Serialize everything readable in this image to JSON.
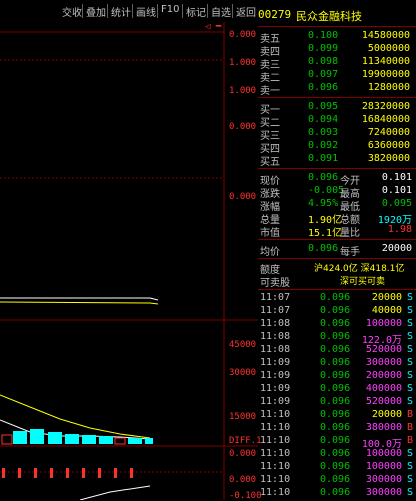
{
  "toolbar": {
    "items": [
      "交收",
      "叠加",
      "统计",
      "画线",
      "F10",
      "标记",
      "自选",
      "返回"
    ]
  },
  "chart": {
    "price_axis": [
      "0.000",
      "1.000",
      "1.000",
      "0.000",
      "0.000"
    ],
    "vol_axis": [
      "45000",
      "30000",
      "15000"
    ],
    "lower_axis": [
      "0.000",
      "0.000",
      "-0.100"
    ],
    "indicator_label": "DIFF.1"
  },
  "stock": {
    "code": "00279",
    "name": "民众金融科技"
  },
  "asks": [
    {
      "label": "卖五",
      "price": "0.100",
      "vol": "14580000"
    },
    {
      "label": "卖四",
      "price": "0.099",
      "vol": "5000000"
    },
    {
      "label": "卖三",
      "price": "0.098",
      "vol": "11340000"
    },
    {
      "label": "卖二",
      "price": "0.097",
      "vol": "19900000"
    },
    {
      "label": "卖一",
      "price": "0.096",
      "vol": "1280000"
    }
  ],
  "bids": [
    {
      "label": "买一",
      "price": "0.095",
      "vol": "28320000"
    },
    {
      "label": "买二",
      "price": "0.094",
      "vol": "16840000"
    },
    {
      "label": "买三",
      "price": "0.093",
      "vol": "7240000"
    },
    {
      "label": "买四",
      "price": "0.092",
      "vol": "6360000"
    },
    {
      "label": "买五",
      "price": "0.091",
      "vol": "3820000"
    }
  ],
  "stats": [
    {
      "l1": "现价",
      "v1": "0.096",
      "l2": "今开",
      "v2": "0.101"
    },
    {
      "l1": "涨跌",
      "v1": "-0.005",
      "l2": "最高",
      "v2": "0.101"
    },
    {
      "l1": "涨幅",
      "v1": "4.95%",
      "l2": "最低",
      "v2": "0.095"
    },
    {
      "l1": "总量",
      "v1": "1.90亿",
      "l2": "总额",
      "v2": "1920万"
    },
    {
      "l1": "市值",
      "v1": "15.1亿",
      "l2": "量比",
      "v2": "1.98"
    }
  ],
  "extra": {
    "l1": "均价",
    "v1": "0.096",
    "l2": "每手",
    "v2": "20000"
  },
  "flow": {
    "label1": "额度",
    "value1": "沪424.0亿 深418.1亿",
    "label2": "可卖股",
    "value2": "深可买可卖"
  },
  "ticks": [
    {
      "time": "11:07",
      "price": "0.096",
      "vol": "20000",
      "bs": "S"
    },
    {
      "time": "11:07",
      "price": "0.096",
      "vol": "40000",
      "bs": "S"
    },
    {
      "time": "11:08",
      "price": "0.096",
      "vol": "100000",
      "bs": "S"
    },
    {
      "time": "11:08",
      "price": "0.096",
      "vol": "122.0万",
      "bs": "S"
    },
    {
      "time": "11:08",
      "price": "0.096",
      "vol": "520000",
      "bs": "S"
    },
    {
      "time": "11:09",
      "price": "0.096",
      "vol": "300000",
      "bs": "S"
    },
    {
      "time": "11:09",
      "price": "0.096",
      "vol": "200000",
      "bs": "S"
    },
    {
      "time": "11:09",
      "price": "0.096",
      "vol": "400000",
      "bs": "S"
    },
    {
      "time": "11:09",
      "price": "0.096",
      "vol": "520000",
      "bs": "S"
    },
    {
      "time": "11:10",
      "price": "0.096",
      "vol": "20000",
      "bs": "B"
    },
    {
      "time": "11:10",
      "price": "0.096",
      "vol": "380000",
      "bs": "B"
    },
    {
      "time": "11:10",
      "price": "0.096",
      "vol": "100.0万",
      "bs": "B"
    },
    {
      "time": "11:10",
      "price": "0.096",
      "vol": "100000",
      "bs": "S"
    },
    {
      "time": "11:10",
      "price": "0.096",
      "vol": "100000",
      "bs": "S"
    },
    {
      "time": "11:10",
      "price": "0.096",
      "vol": "300000",
      "bs": "S"
    },
    {
      "time": "11:10",
      "price": "0.096",
      "vol": "300000",
      "bs": "S"
    }
  ],
  "colors": {
    "up": "#ff3030",
    "down": "#00c000",
    "volume": "#ffff00",
    "buy": "#ff3030",
    "sell": "#00ffff",
    "bg": "#000000"
  }
}
